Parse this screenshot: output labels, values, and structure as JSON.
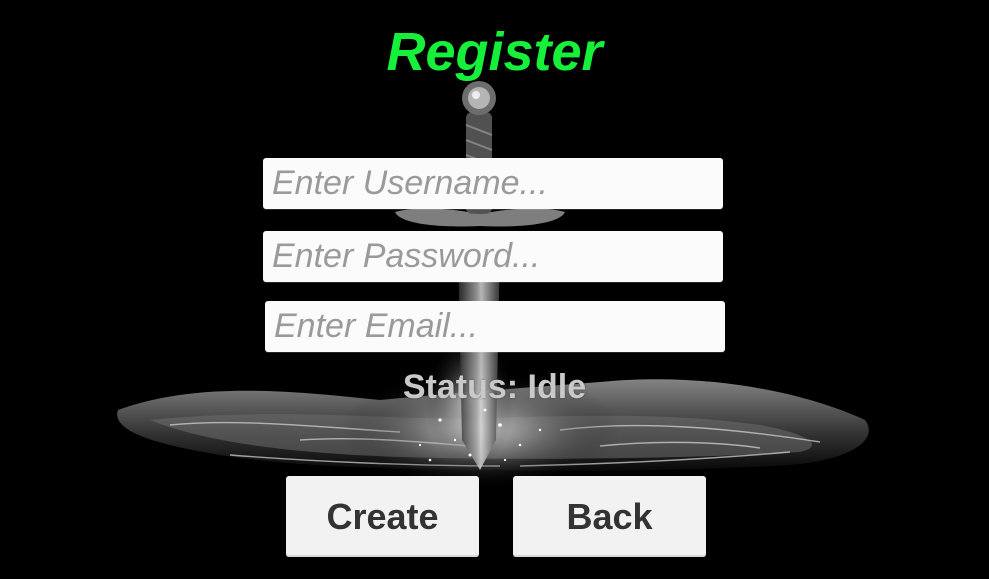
{
  "screen": {
    "title": "Register",
    "title_color": "#17f03a",
    "background_color": "#000000"
  },
  "form": {
    "username": {
      "placeholder": "Enter Username...",
      "value": ""
    },
    "password": {
      "placeholder": "Enter Password...",
      "value": ""
    },
    "email": {
      "placeholder": "Enter Email...",
      "value": ""
    }
  },
  "status": {
    "text": "Status: Idle"
  },
  "buttons": {
    "create_label": "Create",
    "back_label": "Back"
  },
  "background_art": {
    "icon": "sword-in-water-illustration"
  }
}
